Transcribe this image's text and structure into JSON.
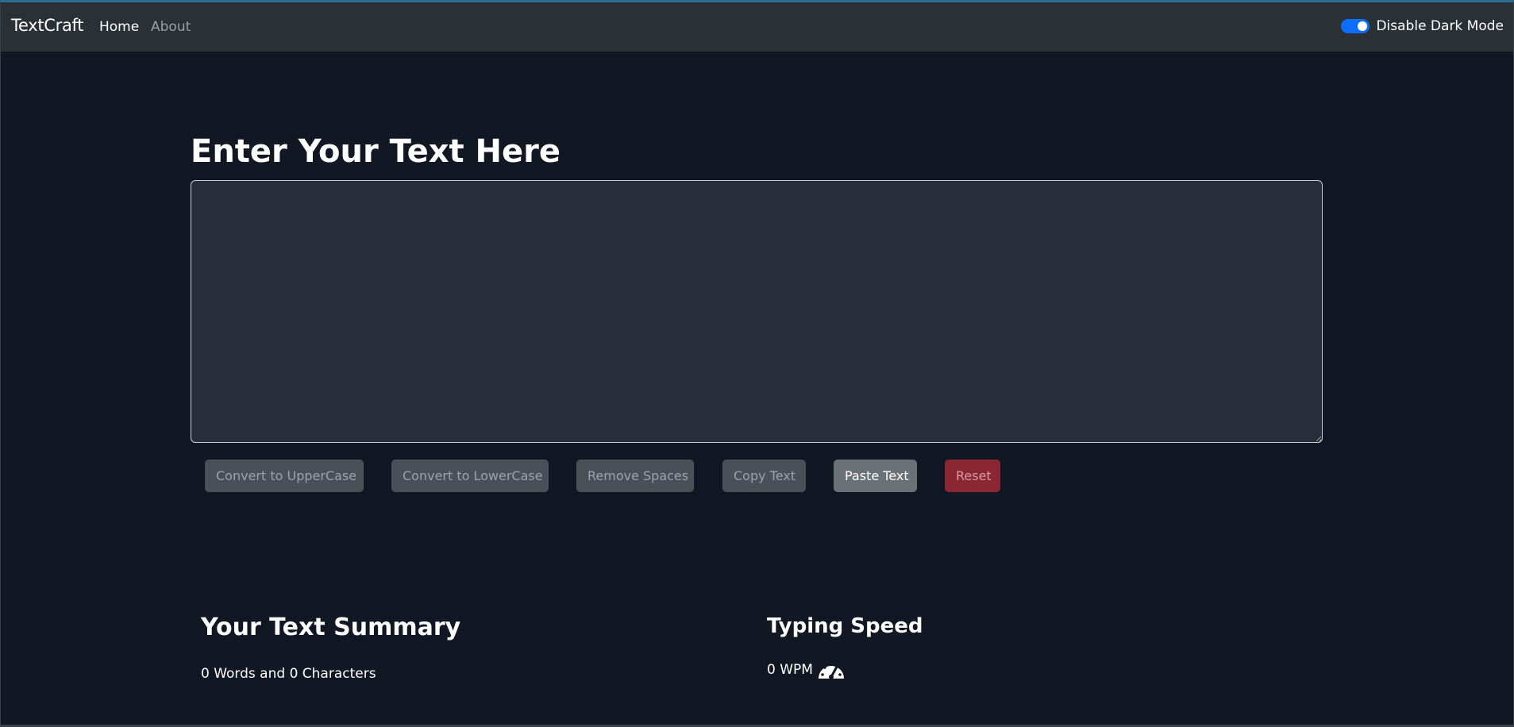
{
  "navbar": {
    "brand": "TextCraft",
    "links": [
      {
        "label": "Home",
        "active": true
      },
      {
        "label": "About",
        "active": false
      }
    ],
    "dark_mode_toggle": {
      "label": "Disable Dark Mode",
      "checked": true
    }
  },
  "main": {
    "heading": "Enter Your Text Here",
    "textarea": {
      "value": "",
      "placeholder": ""
    },
    "buttons": [
      {
        "label": "Convert to UpperCase"
      },
      {
        "label": "Convert to LowerCase"
      },
      {
        "label": "Remove Spaces"
      },
      {
        "label": "Copy Text"
      },
      {
        "label": "Paste Text"
      },
      {
        "label": "Reset"
      }
    ]
  },
  "summary": {
    "title": "Your Text Summary",
    "text": "0 Words and 0 Characters"
  },
  "typing_speed": {
    "title": "Typing Speed",
    "value": "0 WPM",
    "icon": "speedometer-icon"
  },
  "colors": {
    "background": "#111723",
    "navbar": "#2b3035",
    "textarea": "#282d3a",
    "accent": "#0d6efd",
    "danger": "#8a2733"
  }
}
